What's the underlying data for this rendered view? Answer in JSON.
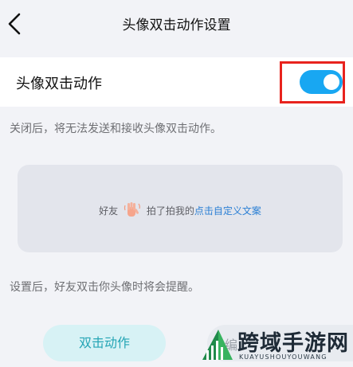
{
  "header": {
    "title": "头像双击动作设置",
    "back_icon": "chevron-left-icon"
  },
  "setting": {
    "label": "头像双击动作",
    "toggle_on": true,
    "toggle_color": "#18a7f2",
    "highlight_color": "#e8231e"
  },
  "notes": {
    "off_hint": "关闭后，将无法发送和接收头像双击动作。",
    "set_hint": "设置后，好友双击你头像时将会提醒。"
  },
  "preview": {
    "friend": "好友",
    "hand_icon": "waving-hand-icon",
    "action_text": "拍了拍我的",
    "custom_link": "点击自定义文案"
  },
  "buttons": {
    "double_tap_action": "双击动作",
    "partial_label": "编"
  },
  "watermark": {
    "main": "跨域手游网",
    "sub": "KUAYUSHOUYOUWANG"
  }
}
